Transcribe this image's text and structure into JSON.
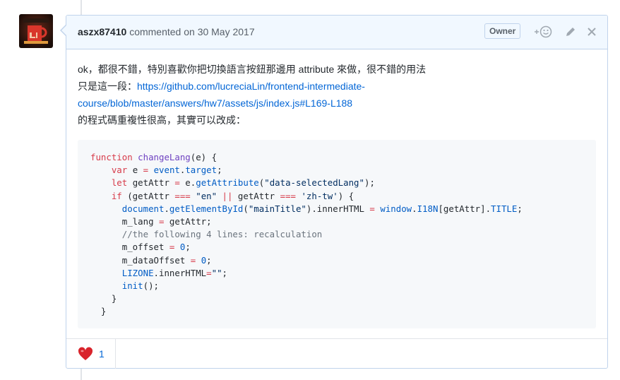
{
  "comment": {
    "author": "aszx87410",
    "action_text": "commented on",
    "date": "30 May 2017",
    "badge": "Owner",
    "add_reaction_icon": "smiley-plus-icon",
    "edit_icon": "pencil-icon",
    "delete_icon": "close-icon",
    "body": {
      "line1": "ok，都很不錯，特別喜歡你把切換語言按鈕那邊用 attribute 來做，很不錯的用法",
      "line2_prefix": "只是這一段：",
      "link_text_1": "https://github.com/lucreciaLin/frontend-intermediate-",
      "link_text_2": "course/blob/master/answers/hw7/assets/js/index.js#L169-L188",
      "line4": "的程式碼重複性很高，其實可以改成："
    },
    "code": {
      "l1_kw": "function",
      "l1_fn": "changeLang",
      "l1_rest": "(e) {",
      "l2_kw": "var",
      "l2_mid": " e ",
      "l2_op": "=",
      "l2_sp": " ",
      "l2_bl": "event",
      "l2_rest": ".",
      "l2_bl2": "target",
      "l2_end": ";",
      "l3_kw": "let",
      "l3_mid": " getAttr ",
      "l3_op": "=",
      "l3_mid2": " e.",
      "l3_bl": "getAttribute",
      "l3_p": "(",
      "l3_st": "\"data-selectedLang\"",
      "l3_end": ");",
      "l4_kw": "if",
      "l4_a": " (getAttr ",
      "l4_op1": "===",
      "l4_sp": " ",
      "l4_st1": "\"en\"",
      "l4_sp2": " ",
      "l4_op2": "||",
      "l4_b": " getAttr ",
      "l4_op3": "===",
      "l4_sp3": " ",
      "l4_st2": "'zh-tw'",
      "l4_end": ") {",
      "l5_bl": "document",
      "l5_dot": ".",
      "l5_fn": "getElementById",
      "l5_p": "(",
      "l5_st": "\"mainTitle\"",
      "l5_mid": ").innerHTML ",
      "l5_op": "=",
      "l5_sp": " ",
      "l5_bl2": "window",
      "l5_dot2": ".",
      "l5_bl3": "I18N",
      "l5_br": "[getAttr].",
      "l5_bl4": "TITLE",
      "l5_end": ";",
      "l6_a": "m_lang ",
      "l6_op": "=",
      "l6_end": " getAttr;",
      "l7_cm": "//the following 4 lines: recalculation",
      "l8_a": "m_offset ",
      "l8_op": "=",
      "l8_sp": " ",
      "l8_num": "0",
      "l8_end": ";",
      "l9_a": "m_dataOffset ",
      "l9_op": "=",
      "l9_sp": " ",
      "l9_num": "0",
      "l9_end": ";",
      "l10_bl": "LIZONE",
      "l10_mid": ".innerHTML",
      "l10_op": "=",
      "l10_st": "\"\"",
      "l10_end": ";",
      "l11_bl": "init",
      "l11_end": "();",
      "l12": "}",
      "l13": "}"
    },
    "reaction": {
      "icon": "heart-icon",
      "count": "1"
    }
  },
  "colors": {
    "header_bg": "#f1f8ff",
    "border": "#c0d3eb",
    "link": "#0366d6",
    "keyword": "#d73a49",
    "builtin": "#005cc5",
    "string": "#032f62",
    "comment": "#6a737d",
    "function": "#6f42c1"
  }
}
